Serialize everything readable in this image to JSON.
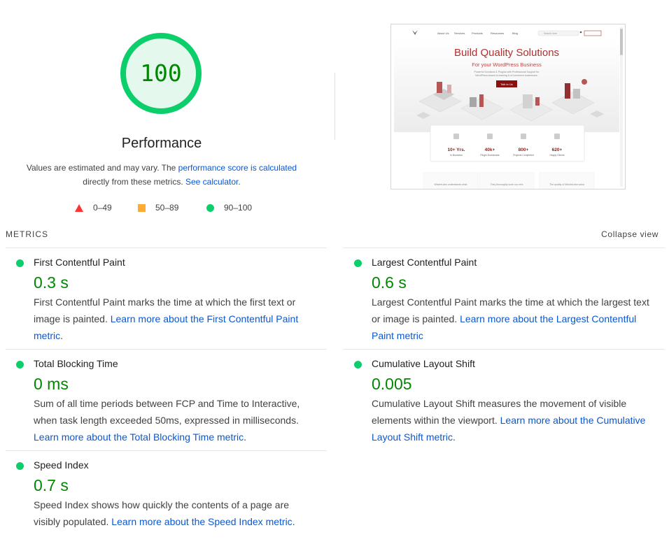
{
  "score": {
    "value": "100",
    "title": "Performance",
    "desc_pre": "Values are estimated and may vary. The ",
    "desc_link1": "performance score is calculated",
    "desc_mid": " directly from these metrics. ",
    "desc_link2": "See calculator",
    "desc_post": ".",
    "colors": {
      "good": "#0cce6b",
      "text_good": "#008800",
      "average": "#ffaa33",
      "fail": "#ff3333"
    }
  },
  "legend": [
    {
      "icon": "triangle-icon",
      "label": "0–49"
    },
    {
      "icon": "square-icon",
      "label": "50–89"
    },
    {
      "icon": "circle-icon",
      "label": "90–100"
    }
  ],
  "screenshot": {
    "nav": [
      "About Us",
      "Services",
      "Products",
      "Resources",
      "Blog"
    ],
    "search_placeholder": "Search here",
    "headline": "Build Quality Solutions",
    "subheadline": "For your WordPress Business",
    "blurb_line1": "Powerful Solutions & Plugins with Professional Support for",
    "blurb_line2": "WordPress-based eLearning & eCommerce businesses.",
    "cta": "Talk to Us",
    "stats": [
      {
        "value": "10+ Yrs.",
        "label": "In Business"
      },
      {
        "value": "40k+",
        "label": "Plugin Downloads"
      },
      {
        "value": "800+",
        "label": "Projects Completed"
      },
      {
        "value": "620+",
        "label": "Happy Clients"
      }
    ],
    "footer_cards": [
      "WisdmLabs understands what",
      "They thoroughly work our vers",
      "The quality of WisdmLabs valua"
    ]
  },
  "metrics": {
    "header": "METRICS",
    "collapse_label": "Collapse view",
    "items": [
      {
        "name": "First Contentful Paint",
        "value": "0.3 s",
        "desc": "First Contentful Paint marks the time at which the first text or image is painted. ",
        "link": "Learn more about the First Contentful Paint metric",
        "post": "."
      },
      {
        "name": "Largest Contentful Paint",
        "value": "0.6 s",
        "desc": "Largest Contentful Paint marks the time at which the largest text or image is painted. ",
        "link": "Learn more about the Largest Contentful Paint metric",
        "post": ""
      },
      {
        "name": "Total Blocking Time",
        "value": "0 ms",
        "desc": "Sum of all time periods between FCP and Time to Interactive, when task length exceeded 50ms, expressed in milliseconds. ",
        "link": "Learn more about the Total Blocking Time metric",
        "post": "."
      },
      {
        "name": "Cumulative Layout Shift",
        "value": "0.005",
        "desc": "Cumulative Layout Shift measures the movement of visible elements within the viewport. ",
        "link": "Learn more about the Cumulative Layout Shift metric",
        "post": "."
      },
      {
        "name": "Speed Index",
        "value": "0.7 s",
        "desc": "Speed Index shows how quickly the contents of a page are visibly populated. ",
        "link": "Learn more about the Speed Index metric",
        "post": "."
      }
    ]
  }
}
